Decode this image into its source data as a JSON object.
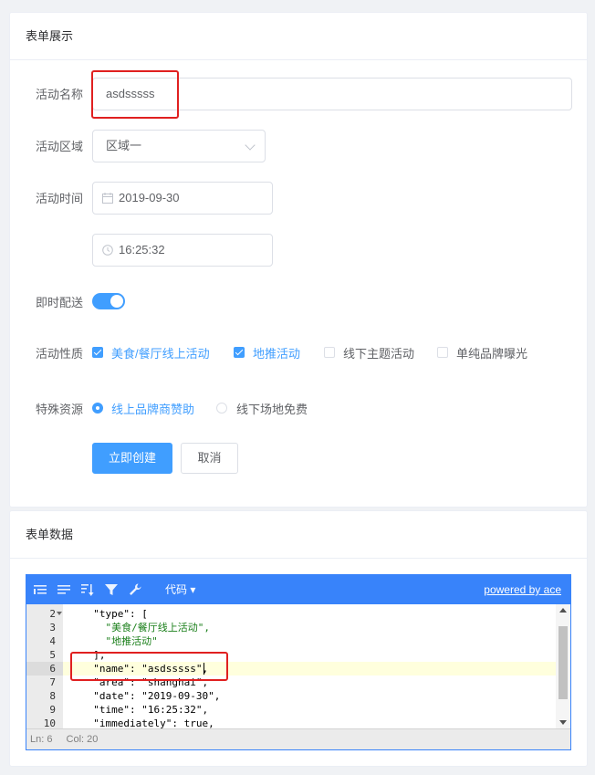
{
  "form_card": {
    "title": "表单展示",
    "name_label": "活动名称",
    "name_value": "asdsssss",
    "region_label": "活动区域",
    "region_value": "区域一",
    "time_label": "活动时间",
    "date_value": "2019-09-30",
    "time_value": "16:25:32",
    "delivery_label": "即时配送",
    "delivery_on": true,
    "type_label": "活动性质",
    "type_options": [
      {
        "label": "美食/餐厅线上活动",
        "checked": true
      },
      {
        "label": "地推活动",
        "checked": true
      },
      {
        "label": "线下主题活动",
        "checked": false
      },
      {
        "label": "单纯品牌曝光",
        "checked": false
      }
    ],
    "resource_label": "特殊资源",
    "resource_options": [
      {
        "label": "线上品牌商赞助",
        "selected": true
      },
      {
        "label": "线下场地免费",
        "selected": false
      }
    ],
    "submit_label": "立即创建",
    "cancel_label": "取消"
  },
  "data_card": {
    "title": "表单数据",
    "editor": {
      "menu_label": "代码 ▾",
      "powered_by": "powered by ace",
      "status_ln": "Ln: 6",
      "status_col": "Col: 20",
      "lines": [
        {
          "num": "2",
          "text": "  \"type\": ["
        },
        {
          "num": "3",
          "text": "    \"美食/餐厅线上活动\","
        },
        {
          "num": "4",
          "text": "    \"地推活动\""
        },
        {
          "num": "5",
          "text": "  ],"
        },
        {
          "num": "6",
          "text": "  \"name\": \"asdsssss\","
        },
        {
          "num": "7",
          "text": "  \"area\": \"shanghai\","
        },
        {
          "num": "8",
          "text": "  \"date\": \"2019-09-30\","
        },
        {
          "num": "9",
          "text": "  \"time\": \"16:25:32\","
        },
        {
          "num": "10",
          "text": "  \"immediately\": true,"
        }
      ]
    }
  },
  "colors": {
    "primary": "#409eff",
    "ace_toolbar": "#3883fa",
    "annotation": "#e02020"
  }
}
